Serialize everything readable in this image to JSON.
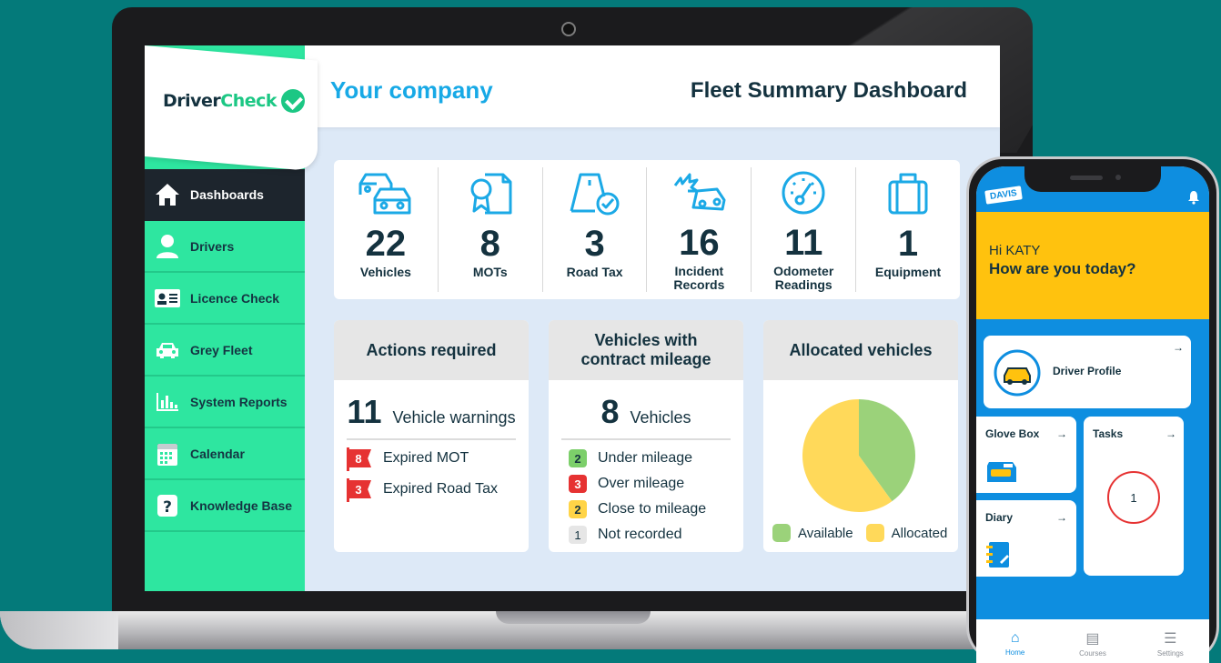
{
  "sidebar": {
    "logo": {
      "part1": "Driver",
      "part2": "Check"
    },
    "items": [
      {
        "label": "Dashboards",
        "icon": "home-icon"
      },
      {
        "label": "Drivers",
        "icon": "user-icon"
      },
      {
        "label": "Licence Check",
        "icon": "id-card-icon"
      },
      {
        "label": "Grey Fleet",
        "icon": "car-icon"
      },
      {
        "label": "System Reports",
        "icon": "bar-chart-icon"
      },
      {
        "label": "Calendar",
        "icon": "calendar-icon"
      },
      {
        "label": "Knowledge Base",
        "icon": "help-icon"
      }
    ]
  },
  "header": {
    "company": "Your company",
    "title": "Fleet Summary Dashboard"
  },
  "stats": [
    {
      "value": "22",
      "label": "Vehicles",
      "icon": "two-cars-icon"
    },
    {
      "value": "8",
      "label": "MOTs",
      "icon": "certificate-icon"
    },
    {
      "value": "3",
      "label": "Road Tax",
      "icon": "road-tax-icon"
    },
    {
      "value": "16",
      "label": "Incident\nRecords",
      "icon": "car-crash-icon"
    },
    {
      "value": "11",
      "label": "Odometer\nReadings",
      "icon": "gauge-icon"
    },
    {
      "value": "1",
      "label": "Equipment",
      "icon": "briefcase-icon"
    }
  ],
  "actions": {
    "title": "Actions required",
    "count": "11",
    "count_label": "Vehicle warnings",
    "items": [
      {
        "num": "8",
        "label": "Expired MOT"
      },
      {
        "num": "3",
        "label": "Expired Road Tax"
      }
    ]
  },
  "mileage": {
    "title": "Vehicles with\ncontract mileage",
    "count": "8",
    "count_label": "Vehicles",
    "items": [
      {
        "num": "2",
        "label": "Under mileage",
        "color": "#7ccf6a"
      },
      {
        "num": "3",
        "label": "Over mileage",
        "color": "#e63232"
      },
      {
        "num": "2",
        "label": "Close to mileage",
        "color": "#ffd447"
      },
      {
        "num": "1",
        "label": "Not recorded",
        "color": "#e6e6e6"
      }
    ]
  },
  "allocated": {
    "title": "Allocated vehicles",
    "legend": [
      {
        "label": "Available",
        "color": "#9bd27a"
      },
      {
        "label": "Allocated",
        "color": "#ffd95a"
      }
    ]
  },
  "chart_data": {
    "type": "pie",
    "categories": [
      "Available",
      "Allocated"
    ],
    "values": [
      40,
      60
    ],
    "colors": [
      "#9bd27a",
      "#ffd95a"
    ]
  },
  "phone": {
    "brand": "DAVIS",
    "greeting": "Hi KATY",
    "question": "How are you today?",
    "tiles": {
      "profile": "Driver Profile",
      "glovebox": "Glove Box",
      "tasks": "Tasks",
      "tasks_count": "1",
      "diary": "Diary"
    },
    "nav": [
      {
        "label": "Home",
        "icon": "home-icon"
      },
      {
        "label": "Courses",
        "icon": "courses-icon"
      },
      {
        "label": "Settings",
        "icon": "menu-icon"
      }
    ]
  }
}
